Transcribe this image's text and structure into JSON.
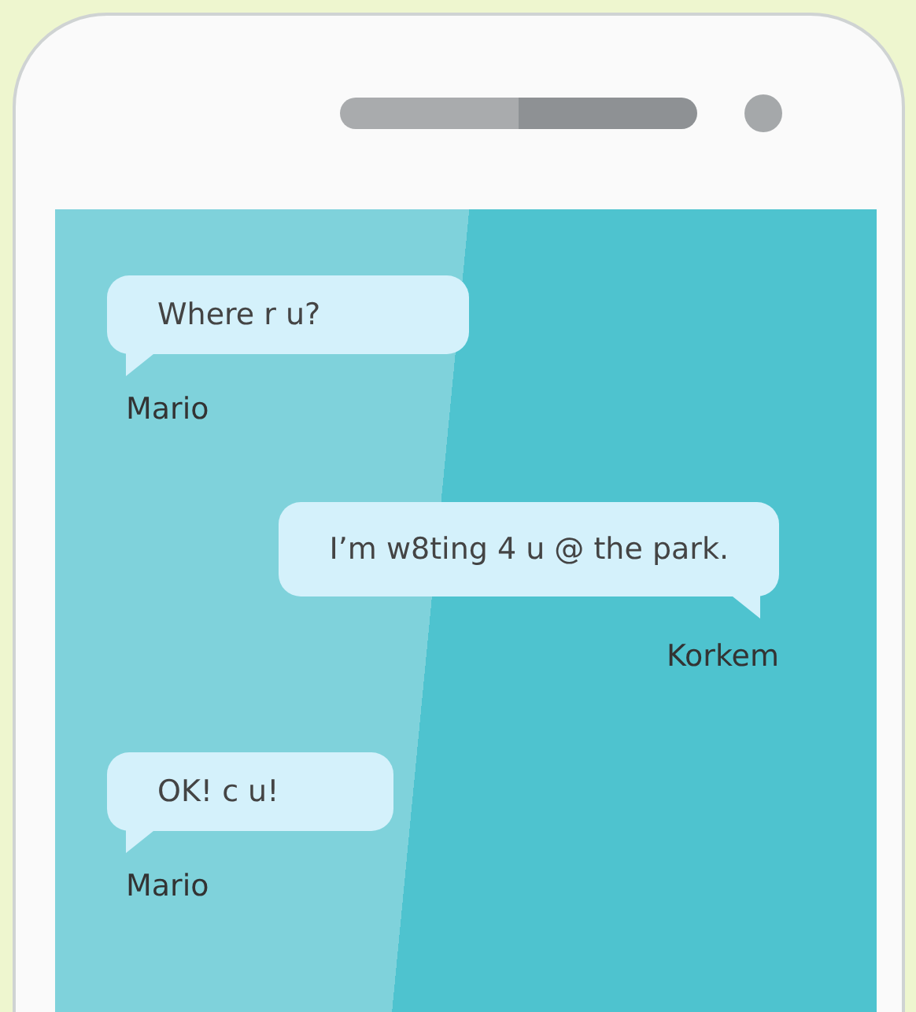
{
  "messages": [
    {
      "text": "Where r u?",
      "sender": "Mario",
      "kind": "incoming"
    },
    {
      "text": "I’m w8ting 4 u @ the park.",
      "sender": "Korkem",
      "kind": "outgoing"
    },
    {
      "text": "OK! c u!",
      "sender": "Mario",
      "kind": "incoming"
    }
  ]
}
